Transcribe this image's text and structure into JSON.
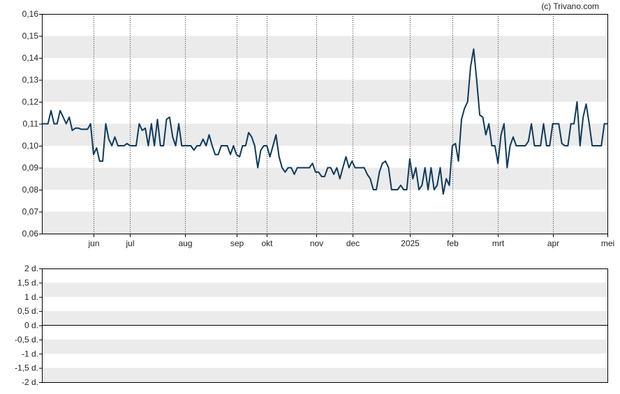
{
  "credit": "(c) Trivano.com",
  "colors": {
    "line": "#0d3a5c",
    "band": "#ebebeb",
    "frame": "#000000",
    "vgrid": "#333333",
    "background": "#ffffff"
  },
  "chart_data": [
    {
      "type": "line",
      "title": "",
      "xlabel": "",
      "ylabel": "",
      "ylim": [
        0.06,
        0.16
      ],
      "y_ticks": [
        "0,16",
        "0,15",
        "0,14",
        "0,13",
        "0,12",
        "0,11",
        "0,10",
        "0,09",
        "0,08",
        "0,07",
        "0,06"
      ],
      "x_ticks": [
        "jun",
        "jul",
        "aug",
        "sep",
        "okt",
        "nov",
        "dec",
        "2025",
        "feb",
        "mrt",
        "apr",
        "mei"
      ],
      "grid": "alternating horizontal bands, dotted vertical lines at month boundaries",
      "legend": "none",
      "series": [
        {
          "values": [
            0.11,
            0.11,
            0.11,
            0.116,
            0.11,
            0.11,
            0.116,
            0.113,
            0.11,
            0.113,
            0.107,
            0.108,
            0.108,
            0.1075,
            0.1075,
            0.1075,
            0.11,
            0.096,
            0.099,
            0.093,
            0.093,
            0.11,
            0.103,
            0.1,
            0.104,
            0.1,
            0.1,
            0.1,
            0.101,
            0.1,
            0.1,
            0.1,
            0.11,
            0.107,
            0.108,
            0.1,
            0.11,
            0.1,
            0.112,
            0.1,
            0.1,
            0.112,
            0.113,
            0.104,
            0.1,
            0.11,
            0.1,
            0.1,
            0.1,
            0.1,
            0.098,
            0.1,
            0.1,
            0.103,
            0.1,
            0.105,
            0.1,
            0.096,
            0.096,
            0.1,
            0.1,
            0.1,
            0.096,
            0.1,
            0.096,
            0.095,
            0.1,
            0.1,
            0.106,
            0.104,
            0.1,
            0.09,
            0.098,
            0.1,
            0.1,
            0.095,
            0.1,
            0.105,
            0.095,
            0.09,
            0.088,
            0.09,
            0.09,
            0.087,
            0.09,
            0.09,
            0.09,
            0.09,
            0.09,
            0.092,
            0.088,
            0.088,
            0.086,
            0.086,
            0.09,
            0.09,
            0.087,
            0.09,
            0.085,
            0.09,
            0.095,
            0.09,
            0.093,
            0.09,
            0.09,
            0.09,
            0.09,
            0.087,
            0.085,
            0.08,
            0.08,
            0.088,
            0.092,
            0.093,
            0.09,
            0.08,
            0.08,
            0.08,
            0.082,
            0.08,
            0.08,
            0.094,
            0.085,
            0.09,
            0.08,
            0.082,
            0.09,
            0.08,
            0.09,
            0.08,
            0.082,
            0.09,
            0.078,
            0.085,
            0.082,
            0.1,
            0.101,
            0.093,
            0.112,
            0.117,
            0.12,
            0.136,
            0.144,
            0.13,
            0.114,
            0.113,
            0.105,
            0.11,
            0.1,
            0.1,
            0.092,
            0.105,
            0.11,
            0.09,
            0.1,
            0.104,
            0.1,
            0.1,
            0.1,
            0.1,
            0.102,
            0.11,
            0.1,
            0.1,
            0.1,
            0.11,
            0.1,
            0.1,
            0.11,
            0.11,
            0.11,
            0.101,
            0.1,
            0.1,
            0.11,
            0.11,
            0.12,
            0.1,
            0.113,
            0.119,
            0.11,
            0.1,
            0.1,
            0.1,
            0.1,
            0.11,
            0.11
          ]
        }
      ]
    },
    {
      "type": "line",
      "title": "",
      "xlabel": "",
      "ylabel": "",
      "ylim": [
        -2,
        2
      ],
      "y_ticks": [
        "2 d.",
        "1,5 d.",
        "1 d.",
        "0,5 d.",
        "0 d.",
        "-0,5 d.",
        "-1 d.",
        "-1,5 d.",
        "-2 d."
      ],
      "grid": "alternating horizontal bands",
      "legend": "none",
      "series": []
    }
  ]
}
